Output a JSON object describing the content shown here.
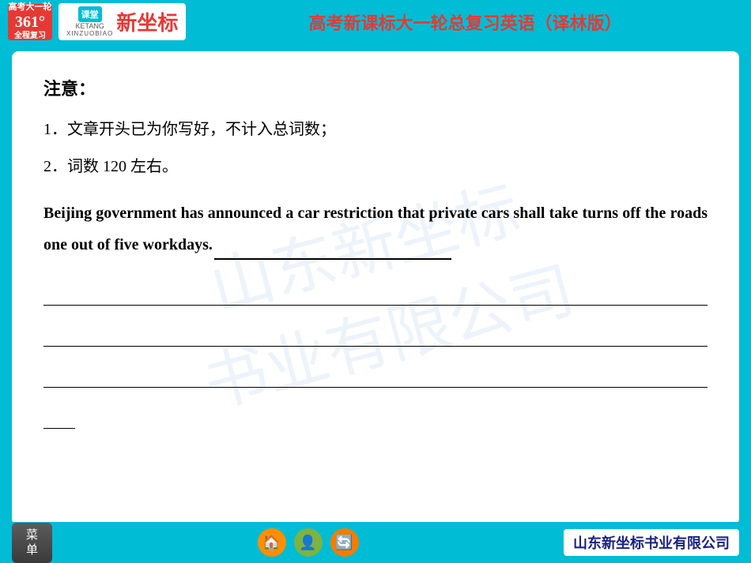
{
  "header": {
    "badge_line1": "高考大一轮",
    "badge_num": "361°",
    "badge_line3": "全程复习",
    "brand_ke": "课堂",
    "brand_xin": "新坐标",
    "brand_ketang": "KETANG",
    "brand_xinzuobiao": "XINZUOBIAO",
    "title": "高考新课标大一轮总复习英语（译林版）"
  },
  "notice": {
    "title": "注意：",
    "item1": "1．文章开头已为你写好，不计入总词数；",
    "item2": "2．词数 120 左右。"
  },
  "article": {
    "text": "Beijing government has announced a car restriction that private cars shall take turns off the roads one out of five workdays."
  },
  "footer": {
    "menu_label": "菜\n单",
    "company": "山东新坐标书业有限公司"
  }
}
